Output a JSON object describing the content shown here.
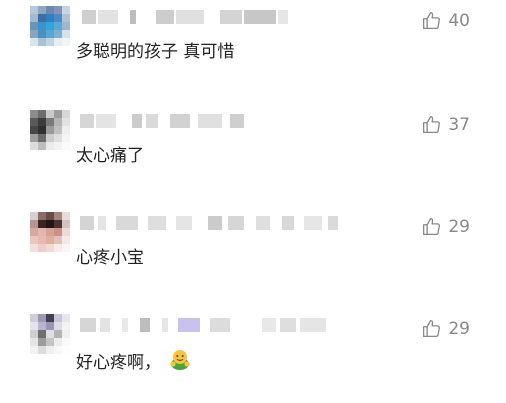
{
  "comments": [
    {
      "text": "多聪明的孩子 真可惜",
      "likes": "40",
      "emoji": false
    },
    {
      "text": "太心痛了",
      "likes": "37",
      "emoji": false
    },
    {
      "text": "心疼小宝",
      "likes": "29",
      "emoji": false
    },
    {
      "text": "好心疼啊，",
      "likes": "29",
      "emoji": true,
      "emoji_name": "hug-emoji"
    }
  ],
  "colors": {
    "text": "#222222",
    "like_count": "#888888",
    "username_pixels": "#cfcfcf"
  }
}
